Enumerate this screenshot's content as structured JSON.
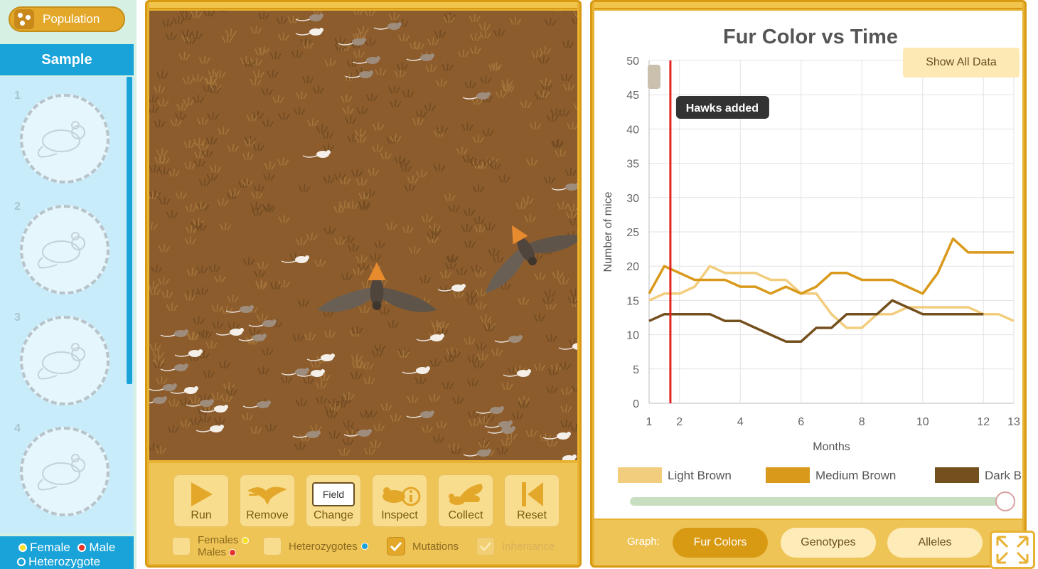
{
  "sidebar": {
    "population_label": "Population",
    "sample_title": "Sample",
    "slots": [
      "1",
      "2",
      "3",
      "4"
    ],
    "legend": {
      "female": "Female",
      "male": "Male",
      "heterozygote": "Heterozygote"
    }
  },
  "controls": {
    "run": "Run",
    "remove": "Remove",
    "field_badge": "Field",
    "change": "Change",
    "inspect": "Inspect",
    "collect": "Collect",
    "reset": "Reset",
    "females": "Females",
    "males": "Males",
    "heterozygotes": "Heterozygotes",
    "mutations": "Mutations",
    "inheritance": "Inheritance"
  },
  "graph": {
    "show_all": "Show All Data",
    "annotation": "Hawks added",
    "buttons_label": "Graph:",
    "buttons": [
      "Fur Colors",
      "Genotypes",
      "Alleles"
    ],
    "slider_fraction": 1.0
  },
  "colors": {
    "light_brown": "#f2cd7e",
    "medium_brown": "#d99a1c",
    "dark_brown": "#74501e",
    "event_line": "#e0231f"
  },
  "chart_data": {
    "type": "line",
    "title": "Fur Color vs Time",
    "xlabel": "Months",
    "ylabel": "Number of mice",
    "ylim": [
      0,
      50
    ],
    "xlim": [
      1,
      13
    ],
    "xticks": [
      "1",
      "2",
      "4",
      "6",
      "8",
      "10",
      "12",
      "13"
    ],
    "yticks": [
      "0",
      "5",
      "10",
      "15",
      "20",
      "25",
      "30",
      "35",
      "40",
      "45",
      "50"
    ],
    "legend": "bottom",
    "grid": true,
    "event": {
      "x": 1.7,
      "label": "Hawks added"
    },
    "series": [
      {
        "name": "Light Brown",
        "color": "#f2cd7e",
        "x": [
          1,
          1.5,
          2,
          2.5,
          3,
          3.5,
          4,
          4.5,
          5,
          5.5,
          6,
          6.5,
          7,
          7.5,
          8,
          8.5,
          9,
          9.5,
          10,
          10.5,
          11,
          11.5,
          12,
          12.5,
          13
        ],
        "y": [
          15,
          16,
          16,
          17,
          20,
          19,
          19,
          19,
          18,
          18,
          16,
          16,
          13,
          11,
          11,
          13,
          13,
          14,
          14,
          14,
          14,
          14,
          13,
          13,
          12
        ]
      },
      {
        "name": "Medium Brown",
        "color": "#d99a1c",
        "x": [
          1,
          1.5,
          2,
          2.5,
          3,
          3.5,
          4,
          4.5,
          5,
          5.5,
          6,
          6.5,
          7,
          7.5,
          8,
          8.5,
          9,
          9.5,
          10,
          10.5,
          11,
          11.5,
          12,
          12.5,
          13
        ],
        "y": [
          16,
          20,
          19,
          18,
          18,
          18,
          17,
          17,
          16,
          17,
          16,
          17,
          19,
          19,
          18,
          18,
          18,
          17,
          16,
          19,
          24,
          22,
          22,
          22,
          22
        ]
      },
      {
        "name": "Dark Brown",
        "color": "#74501e",
        "x": [
          1,
          1.5,
          2,
          2.5,
          3,
          3.5,
          4,
          4.5,
          5,
          5.5,
          6,
          6.5,
          7,
          7.5,
          8,
          8.5,
          9,
          9.5,
          10,
          10.5,
          11,
          11.5,
          12
        ],
        "y": [
          12,
          13,
          13,
          13,
          13,
          12,
          12,
          11,
          10,
          9,
          9,
          11,
          11,
          13,
          13,
          13,
          15,
          14,
          13,
          13,
          13,
          13,
          13
        ]
      }
    ]
  }
}
